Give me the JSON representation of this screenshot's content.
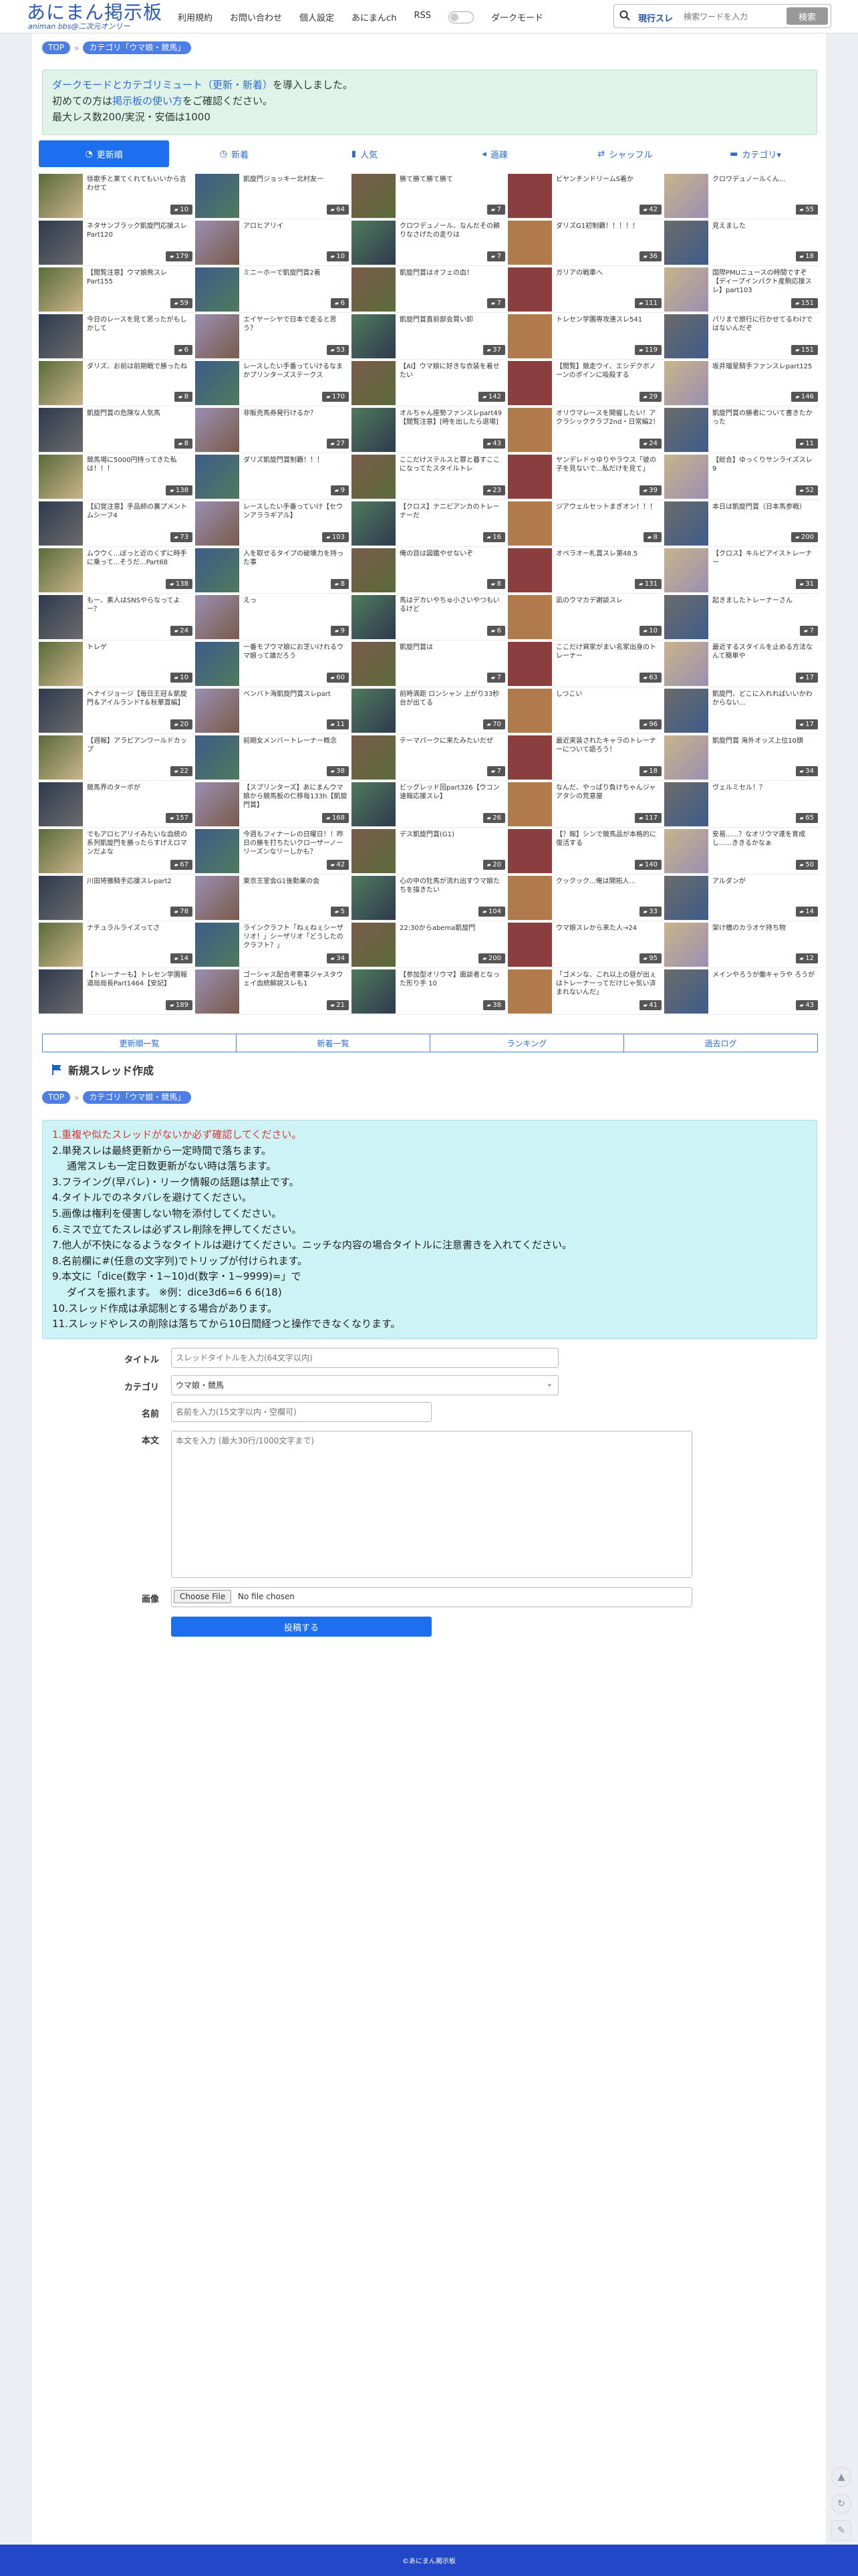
{
  "header": {
    "logo_title": "あにまん掲示板",
    "logo_sub": "animan bbs@二次元オンリー",
    "nav": [
      "利用規約",
      "お問い合わせ",
      "個人設定",
      "あにまんch",
      "RSS"
    ],
    "dark_mode_label": "ダークモード",
    "search_mode": "現行スレ",
    "search_placeholder": "検索ワードを入力",
    "search_button": "検索"
  },
  "breadcrumb": {
    "top": "TOP",
    "category": "カテゴリ「ウマ娘・競馬」"
  },
  "notice": {
    "line1_link": "ダークモードとカテゴリミュート（更新・新着）",
    "line1_rest": "を導入しました。",
    "line2_pre": "初めての方は",
    "line2_link": "掲示板の使い方",
    "line2_rest": "をご確認ください。",
    "line3": "最大レス数200/実況・安価は1000"
  },
  "tabs": [
    "更新順",
    "新着",
    "人気",
    "過疎",
    "シャッフル",
    "カテゴリ▾"
  ],
  "threads": [
    {
      "t": "徐歌手と果てくれてもいいから言わせて",
      "c": "10"
    },
    {
      "t": "凱旋門ジョッキー北村友一",
      "c": "64"
    },
    {
      "t": "勝て勝て勝て勝て",
      "c": "7"
    },
    {
      "t": "ビヤンチンドリームS着か",
      "c": "42"
    },
    {
      "t": "クロワデュノールくん...",
      "c": "55"
    },
    {
      "t": "ネタサンブラック凱旋門応援スレPart120",
      "c": "179"
    },
    {
      "t": "アロヒアリイ",
      "c": "10"
    },
    {
      "t": "クロワデュノール、なんだその頼りなさげたの走りは",
      "c": "7"
    },
    {
      "t": "ダリズG1初制覇！！！！！",
      "c": "36"
    },
    {
      "t": "見えました",
      "c": "18"
    },
    {
      "t": "【閲覧注意】ウマ娘熊スレPart155",
      "c": "59"
    },
    {
      "t": "ミニーホーで凱旋門賞2着",
      "c": "6"
    },
    {
      "t": "凱旋門賞はオフェの血！",
      "c": "7"
    },
    {
      "t": "ガリアの戦車へ",
      "c": "111"
    },
    {
      "t": "国際PMUニュースの時間ですぞ【ディープインパクト産駒応援スレ】part103",
      "c": "151"
    },
    {
      "t": "今日のレースを見て思ったがもしかして",
      "c": "6"
    },
    {
      "t": "エイヤーシヤで日本で走ると思う？",
      "c": "53"
    },
    {
      "t": "凱旋門賞直前部会買い卸",
      "c": "37"
    },
    {
      "t": "トレセン学園専攻連スレ541",
      "c": "119"
    },
    {
      "t": "パリまで旅行に行かせてるわけではないんだぞ",
      "c": "151"
    },
    {
      "t": "ダリズ、お前は前期戦で勝ったね",
      "c": "8"
    },
    {
      "t": "レースしたい手番っていけるなまかプリンターズステークス",
      "c": "170"
    },
    {
      "t": "【AI】ウマ娘に好きな衣装を着せたい",
      "c": "142"
    },
    {
      "t": "【閲覧】競走ウイ、エシデクボノーンのポインに吸殺する",
      "c": "29"
    },
    {
      "t": "坂井瑠星騎手ファンスレpart125",
      "c": "146"
    },
    {
      "t": "凱旋門賞の危険な人気馬",
      "c": "8"
    },
    {
      "t": "非販売馬券発行けるか？",
      "c": "27"
    },
    {
      "t": "オルちゃん座勢ファンスレpart49【閲覧注意】[時を出したら退場]",
      "c": "43"
    },
    {
      "t": "オリウマレースを開催したい！アクラシッククラブ2nd・日常編2！",
      "c": "24"
    },
    {
      "t": "凱旋門賞の勝者について書きたかった",
      "c": "11"
    },
    {
      "t": "競馬場に5000円持ってきた私は！！！",
      "c": "138"
    },
    {
      "t": "ダリズ凱旋門賞制覇！！！",
      "c": "9"
    },
    {
      "t": "ここだけステルスと罪と暮すここになってたスタイルトレ",
      "c": "23"
    },
    {
      "t": "ヤンデレドゥゆりやラウス「彼の子を見ないで...私だけを見て」",
      "c": "39"
    },
    {
      "t": "【総合】ゆっくりサンライズスレ9",
      "c": "52"
    },
    {
      "t": "【幻覚注意】手品師の裏プメントムシーフ4",
      "c": "73"
    },
    {
      "t": "レースしたい手番っていけ【セウンアララギアル】",
      "c": "103"
    },
    {
      "t": "【クロス】ナニビアンカのトレーナーだ",
      "c": "16"
    },
    {
      "t": "ジアウェルセットまぎオン！！！",
      "c": "8"
    },
    {
      "t": "本日は凱旋門賞（日本馬参戦）",
      "c": "200"
    },
    {
      "t": "ムウウく...ぼっと近のくずに時手に乗って...そうだ...Part68",
      "c": "138"
    },
    {
      "t": "入を取せるタイプの破壊力を持った事",
      "c": "8"
    },
    {
      "t": "俺の目は図鑑やせないぞ",
      "c": "8"
    },
    {
      "t": "オペラオー札賞スレ第48.5",
      "c": "131"
    },
    {
      "t": "【クロス】キルピアイストレーナー",
      "c": "31"
    },
    {
      "t": "もー、素人はSNSやらなってよー？",
      "c": "24"
    },
    {
      "t": "えっ",
      "c": "9"
    },
    {
      "t": "馬はデカいやちゅ小さいやつもいるけど",
      "c": "6"
    },
    {
      "t": "凪のウマカデ謝談スレ",
      "c": "10"
    },
    {
      "t": "起きましたトレーナーさん",
      "c": "7"
    },
    {
      "t": "トレゲ",
      "c": "10"
    },
    {
      "t": "一番モブウマ娘にお芝いけれるウマ娘って誰だろう",
      "c": "60"
    },
    {
      "t": "凱旋門賞は",
      "c": "7"
    },
    {
      "t": "ここだけ資家がまい名家出身のトレーナー",
      "c": "63"
    },
    {
      "t": "最近するスタイルを止める方法なんて簡単や",
      "c": "17"
    },
    {
      "t": "ヘナイジョージ【毎日王冠＆凱旋門＆アイルランドT＆秋華賞編】",
      "c": "20"
    },
    {
      "t": "ベンバト海凱旋門賞スレpart",
      "c": "11"
    },
    {
      "t": "前時満距 ロンシャン 上がり33秒台が出てる",
      "c": "70"
    },
    {
      "t": "しつこい",
      "c": "96"
    },
    {
      "t": "凱旋門、どこに入れればいいかわからない...",
      "c": "17"
    },
    {
      "t": "【週報】アラビアンワールドカップ",
      "c": "22"
    },
    {
      "t": "前期女メンバートレーナー概念",
      "c": "38"
    },
    {
      "t": "テーマパークに来たみたいだぜ",
      "c": "7"
    },
    {
      "t": "最近実装されたキャラのトレーナーについて語ろう！",
      "c": "18"
    },
    {
      "t": "凱旋門賞 海外オッズ上位10頭",
      "c": "34"
    },
    {
      "t": "競馬界のターボが",
      "c": "157"
    },
    {
      "t": "【スプリンターズ】あにまんウマ娘から競馬板の仁移毎133h【凱旋門賞】",
      "c": "168"
    },
    {
      "t": "ビッグレッド回part326【ウコン速報応援スレ】",
      "c": "26"
    },
    {
      "t": "なんだ、やっぱり負けちゃんジャアタシの荒意屋",
      "c": "117"
    },
    {
      "t": "ヴェルミセル！？",
      "c": "65"
    },
    {
      "t": "でもアロヒアリイみたいな血統の系列凱旋門を勝ったらすげえロマンだよな",
      "c": "67"
    },
    {
      "t": "今週もフィナーレの日曜日！！昨日の勝を打ちたいクローザーノーリーズンなリーしかも？",
      "c": "42"
    },
    {
      "t": "デス凱旋門賞(G1)",
      "c": "20"
    },
    {
      "t": "【？報】シンで競馬品が本格的に復活する",
      "c": "140"
    },
    {
      "t": "安易......？なオリウマ達を育成し......ききるかなぁ",
      "c": "50"
    },
    {
      "t": "川田将雅騎手応援スレpart2",
      "c": "78"
    },
    {
      "t": "東京王室会G1後勤業の会",
      "c": "5"
    },
    {
      "t": "心の中の牡馬が流れ出すウマ娘たちを描きたい",
      "c": "104"
    },
    {
      "t": "クックック...俺は開拓人...",
      "c": "33"
    },
    {
      "t": "アルダンが",
      "c": "14"
    },
    {
      "t": "ナチュラルライズってさ",
      "c": "14"
    },
    {
      "t": "ラインクラフト「ねぇねぇシーザリオ！」シーザリオ「どうしたのクラフト？」",
      "c": "34"
    },
    {
      "t": "22:30からabema凱旋門",
      "c": "200"
    },
    {
      "t": "ウマ娘スレから来た人→24",
      "c": "95"
    },
    {
      "t": "架け橋のカラオケ持ち物",
      "c": "12"
    },
    {
      "t": "【トレーナーも】トレセン学園報道局局長Part1464【安記】",
      "c": "189"
    },
    {
      "t": "ゴーシャス配合考察事ジャスタウェイ血統解説スレも1",
      "c": "21"
    },
    {
      "t": "【参加型オリウマ】面談者となった形り手 10",
      "c": "38"
    },
    {
      "t": "「ゴメンな、これ以上の昼が出ぇはトレーナーってだけじゃ気い済まれないんだ」",
      "c": "41"
    },
    {
      "t": "メインやろうが働キャラや ろうが",
      "c": "43"
    }
  ],
  "bottom_links": [
    "更新順一覧",
    "新着一覧",
    "ランキング",
    "過去ログ"
  ],
  "new_thread": {
    "heading": "新規スレッド作成",
    "rules": [
      "1.重複や似たスレッドがないか必ず確認してください。",
      "2.単発スレは最終更新から一定時間で落ちます。",
      "通常スレも一定日数更新がない時は落ちます。",
      "3.フライング(早バレ)・リーク情報の話題は禁止です。",
      "4.タイトルでのネタバレを避けてください。",
      "5.画像は権利を侵害しない物を添付してください。",
      "6.ミスで立てたスレは必ずスレ削除を押してください。",
      "7.他人が不快になるようなタイトルは避けてください。ニッチな内容の場合タイトルに注意書きを入れてください。",
      "8.名前欄に#(任意の文字列)でトリップが付けられます。",
      "9.本文に「dice(数字・1~10)d(数字・1~9999)=」で",
      "ダイスを振れます。 ※例：dice3d6=6 6 6(18)",
      "10.スレッド作成は承認制とする場合があります。",
      "11.スレッドやレスの削除は落ちてから10日間経つと操作できなくなります。"
    ],
    "label_title": "タイトル",
    "ph_title": "スレッドタイトルを入力(64文字以内)",
    "label_category": "カテゴリ",
    "category_value": "ウマ娘・競馬",
    "label_name": "名前",
    "ph_name": "名前を入力(15文字以内・空欄可)",
    "label_body": "本文",
    "ph_body": "本文を入力 (最大30行/1000文字まで)",
    "label_image": "画像",
    "file_button": "Choose File",
    "file_status": "No file chosen",
    "submit": "投稿する"
  },
  "footer": "©あにまん掲示板",
  "colors": {
    "accent": "#1e6ff0",
    "brand": "#2a59b8",
    "notice_bg": "#dff3e8",
    "rules_bg": "#cdf3f4",
    "footer": "#2347c9"
  }
}
